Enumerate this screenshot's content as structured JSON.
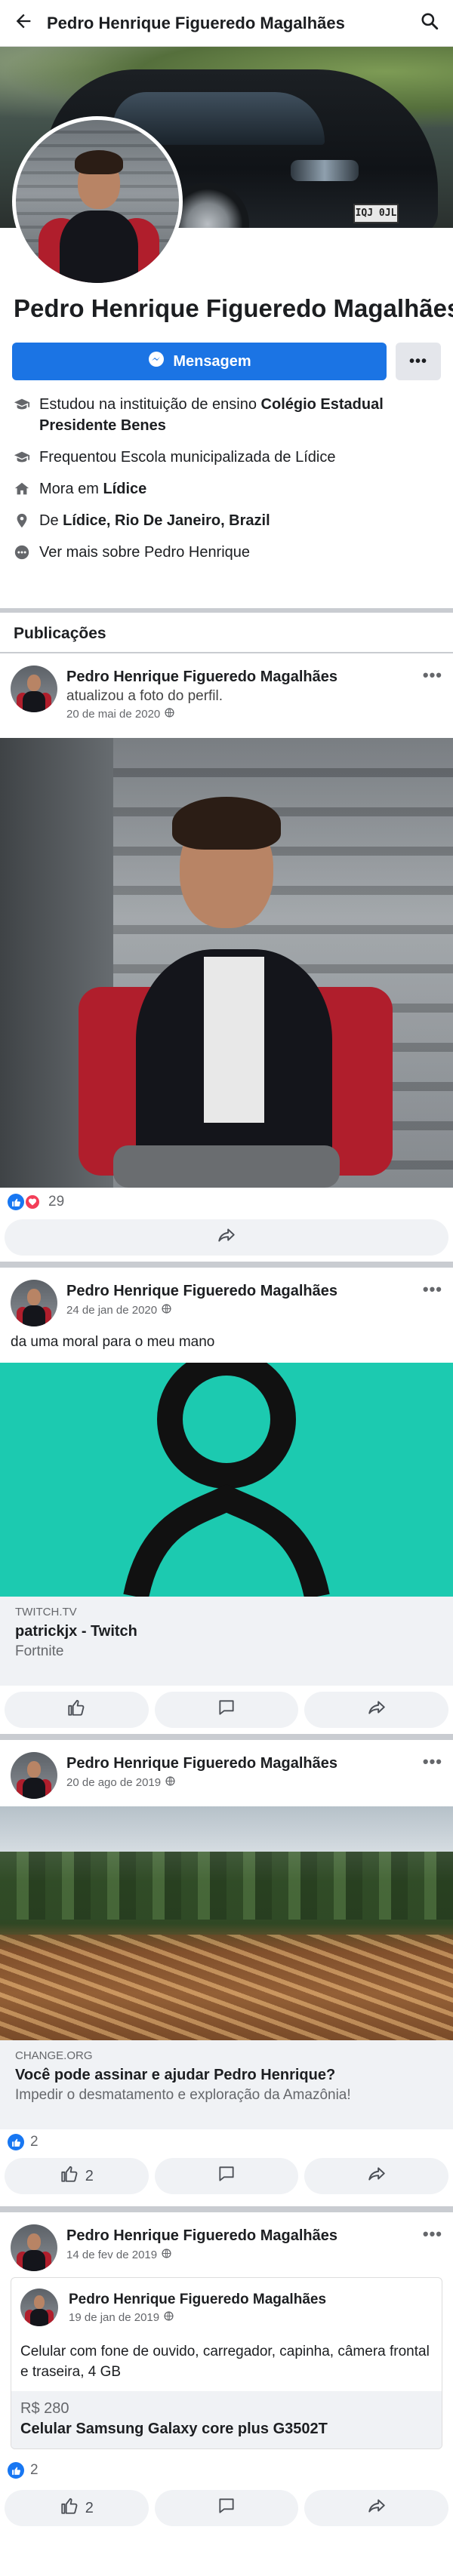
{
  "header": {
    "title": "Pedro Henrique Figueredo Magalhães",
    "back_icon": "arrow-left-icon",
    "search_icon": "search-icon"
  },
  "profile": {
    "cover_plate": "IQJ 0JL",
    "name": "Pedro Henrique Figueredo Magalhães",
    "message_label": "Mensagem",
    "more_label": "•••",
    "info": [
      {
        "icon": "graduation-cap-icon",
        "text": "Estudou na instituição de ensino ",
        "bold": "Colégio Estadual Presidente Benes"
      },
      {
        "icon": "graduation-cap-icon",
        "text": "Frequentou Escola municipalizada de Lídice",
        "bold": ""
      },
      {
        "icon": "home-icon",
        "text": "Mora em ",
        "bold": "Lídice"
      },
      {
        "icon": "location-pin-icon",
        "text": "De ",
        "bold": "Lídice, Rio De Janeiro, Brazil"
      },
      {
        "icon": "more-dots-icon",
        "text": "Ver mais sobre Pedro Henrique",
        "bold": ""
      }
    ]
  },
  "publications_title": "Publicações",
  "posts": [
    {
      "author": "Pedro Henrique Figueredo Magalhães",
      "subtitle": "atualizou a foto do perfil.",
      "date": "20 de mai de 2020",
      "reaction_count": "29",
      "more": "•••"
    },
    {
      "author": "Pedro Henrique Figueredo Magalhães",
      "date": "24 de jan de 2020",
      "text": "da uma moral para o meu mano",
      "link_source": "TWITCH.TV",
      "link_title": "patrickjx - Twitch",
      "link_desc": "Fortnite",
      "more": "•••"
    },
    {
      "author": "Pedro Henrique Figueredo Magalhães",
      "date": "20 de ago de 2019",
      "link_source": "CHANGE.ORG",
      "link_title": "Você pode assinar e ajudar Pedro Henrique?",
      "link_desc": "Impedir o desmatamento e exploração da Amazônia!",
      "reaction_count": "2",
      "like_count": "2",
      "more": "•••"
    },
    {
      "author": "Pedro Henrique Figueredo Magalhães",
      "date": "14 de fev de 2019",
      "shared_author": "Pedro Henrique Figueredo Magalhães",
      "shared_date": "19 de jan de 2019",
      "shared_text": "Celular com fone de ouvido, carregador, capinha, câmera frontal e traseira, 4 GB",
      "price": "R$ 280",
      "product": "Celular Samsung Galaxy core plus G3502T",
      "reaction_count": "2",
      "like_count": "2",
      "more": "•••"
    }
  ],
  "colors": {
    "accent": "#1b74e4",
    "background": "#c9ccd1",
    "twitch_bg": "#1ccab0"
  }
}
